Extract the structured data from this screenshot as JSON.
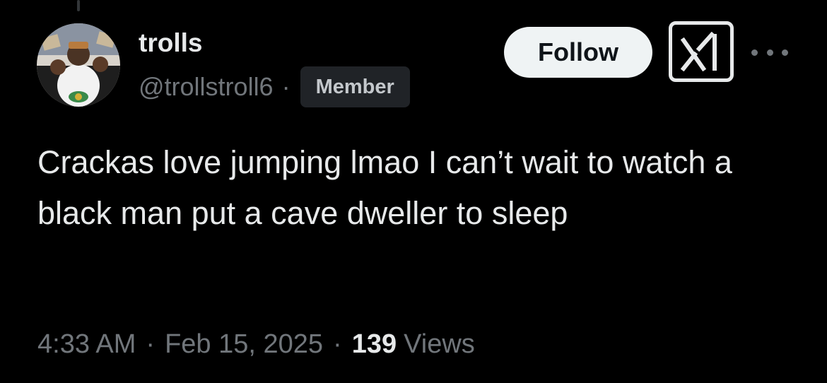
{
  "user": {
    "display_name": "trolls",
    "handle": "@trollstroll6",
    "separator": "·",
    "badge": "Member"
  },
  "actions": {
    "follow_label": "Follow",
    "grok_icon": "xai-logo-icon",
    "more_icon": "more-dots-icon"
  },
  "tweet": {
    "text": "Crackas love jumping lmao I can’t wait to watch a black man put a cave dweller to sleep"
  },
  "meta": {
    "time": "4:33 AM",
    "sep1": "·",
    "date": "Feb 15, 2025",
    "sep2": "·",
    "views_count": "139",
    "views_label": "Views"
  },
  "colors": {
    "background": "#000000",
    "text_primary": "#e7e9ea",
    "text_secondary": "#71767b",
    "follow_bg": "#eff3f4",
    "badge_bg": "#202327"
  }
}
